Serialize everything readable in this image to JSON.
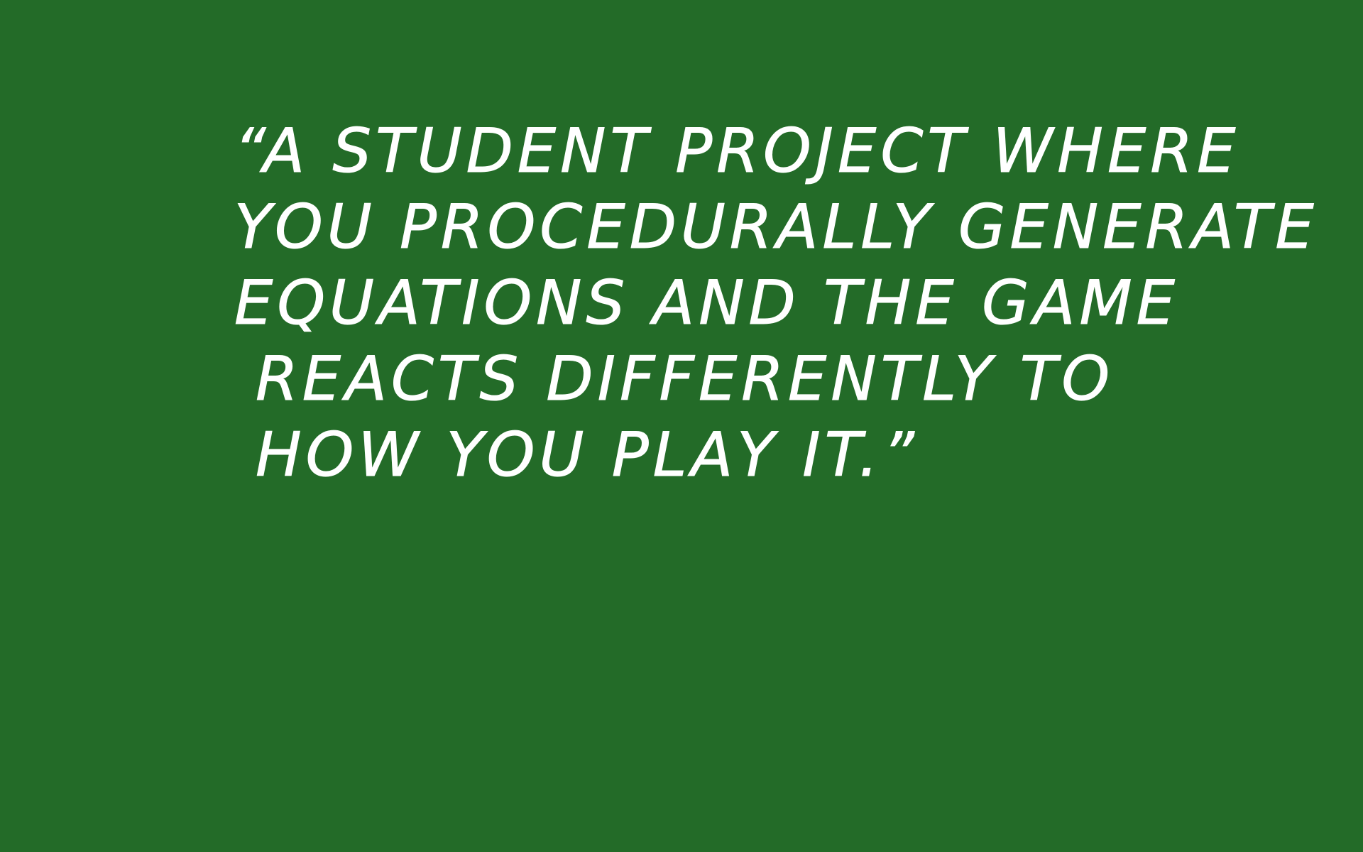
{
  "background_color": "#236b28",
  "text_color": "#ffffff",
  "quote": {
    "lines": [
      "“A STUDENT PROJECT WHERE",
      "YOU PROCEDURALLY GENERATE",
      "EQUATIONS AND THE GAME",
      "REACTS DIFFERENTLY TO",
      "HOW YOU PLAY IT.”"
    ]
  }
}
